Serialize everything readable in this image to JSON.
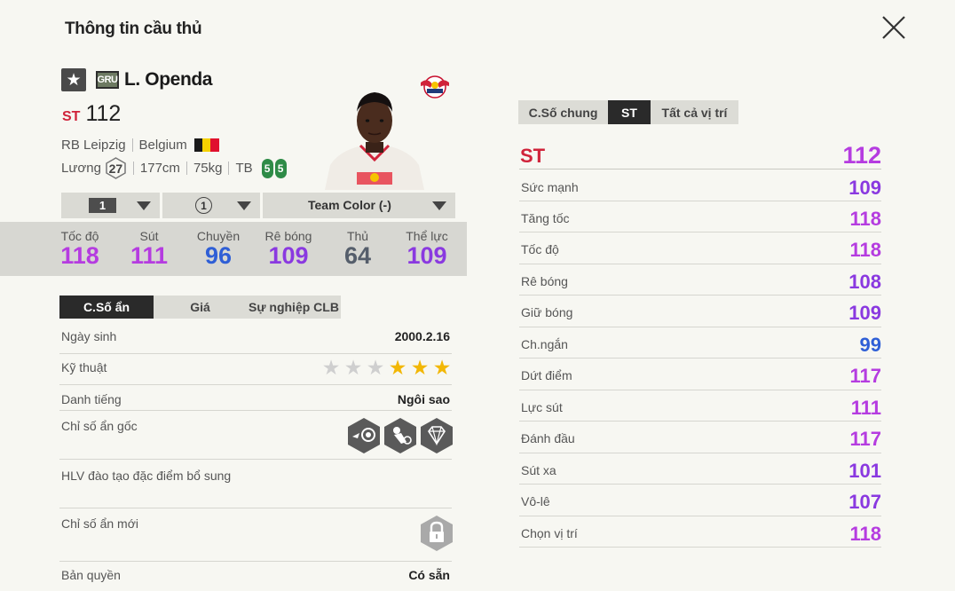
{
  "header": {
    "title": "Thông tin cầu thủ"
  },
  "player": {
    "season_badge": "GRU",
    "name": "L. Openda",
    "position": "ST",
    "ovr": "112",
    "club": "RB Leipzig",
    "nation": "Belgium",
    "wage_label": "Lương",
    "wage": "27",
    "height": "177cm",
    "weight": "75kg",
    "body_type": "TB",
    "left_foot": "5",
    "right_foot": "5",
    "flag_colors": [
      "#1a1a1a",
      "#f5d000",
      "#e0102e"
    ]
  },
  "selectors": {
    "upgrade_level": "1",
    "team_color_level": "1",
    "team_color": "Team Color (-)"
  },
  "summary_stats": [
    {
      "label": "Tốc độ",
      "value": "118",
      "color": "#b53ce0"
    },
    {
      "label": "Sút",
      "value": "111",
      "color": "#b53ce0"
    },
    {
      "label": "Chuyền",
      "value": "96",
      "color": "#2f5fd6"
    },
    {
      "label": "Rê bóng",
      "value": "109",
      "color": "#8a39e0"
    },
    {
      "label": "Thủ",
      "value": "64",
      "color": "#555e6b"
    },
    {
      "label": "Thể lực",
      "value": "109",
      "color": "#8a39e0"
    }
  ],
  "info_tabs": [
    "C.Số ẩn",
    "Giá",
    "Sự nghiệp CLB"
  ],
  "info": {
    "birth_label": "Ngày sinh",
    "birth": "2000.2.16",
    "skill_label": "Kỹ thuật",
    "skill_stars": 3,
    "skill_max": 5,
    "rep_label": "Danh tiếng",
    "rep": "Ngôi sao",
    "traits_label": "Chỉ số ẩn gốc",
    "coach_label": "HLV đào tạo đặc điểm bổ sung",
    "new_traits_label": "Chỉ số ẩn mới",
    "license_label": "Bản quyền",
    "license": "Có sẵn"
  },
  "icons": {
    "close": "close-icon",
    "star": "star-icon",
    "lock": "lock-icon",
    "trait1": "trait-icon",
    "trait2": "trait-icon",
    "trait3": "diamond-icon"
  },
  "right_tabs": [
    "C.Số chung",
    "ST",
    "Tất cả vị trí"
  ],
  "position_header": {
    "label": "ST",
    "value": "112"
  },
  "attributes": [
    {
      "label": "Sức mạnh",
      "value": "109",
      "color": "#8a39e0"
    },
    {
      "label": "Tăng tốc",
      "value": "118",
      "color": "#b53ce0"
    },
    {
      "label": "Tốc độ",
      "value": "118",
      "color": "#b53ce0"
    },
    {
      "label": "Rê bóng",
      "value": "108",
      "color": "#8a39e0"
    },
    {
      "label": "Giữ bóng",
      "value": "109",
      "color": "#8a39e0"
    },
    {
      "label": "Ch.ngắn",
      "value": "99",
      "color": "#2f5fd6"
    },
    {
      "label": "Dứt điểm",
      "value": "117",
      "color": "#b53ce0"
    },
    {
      "label": "Lực sút",
      "value": "111",
      "color": "#b53ce0"
    },
    {
      "label": "Đánh đầu",
      "value": "117",
      "color": "#b53ce0"
    },
    {
      "label": "Sút xa",
      "value": "101",
      "color": "#8a39e0"
    },
    {
      "label": "Vô-lê",
      "value": "107",
      "color": "#8a39e0"
    },
    {
      "label": "Chọn vị trí",
      "value": "118",
      "color": "#b53ce0"
    }
  ]
}
